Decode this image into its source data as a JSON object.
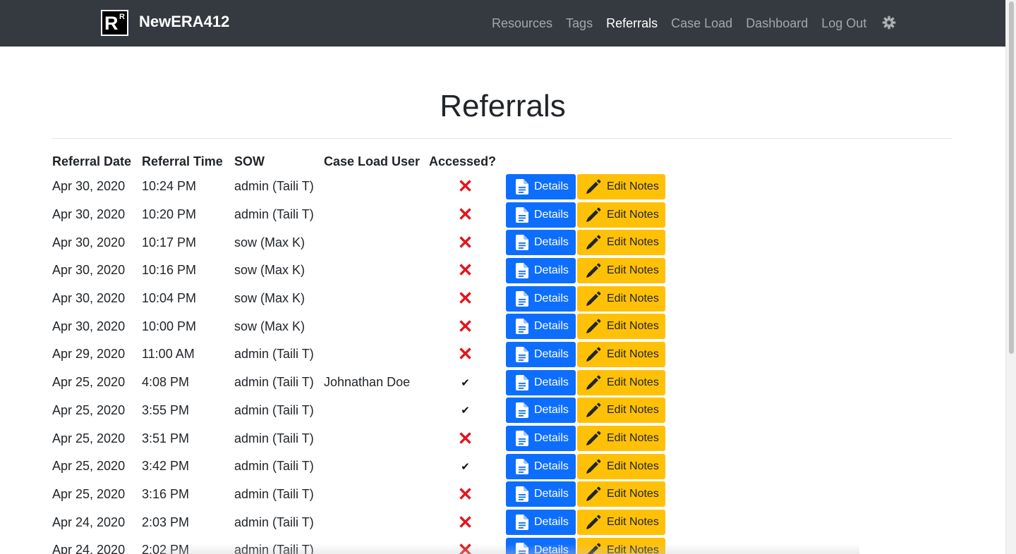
{
  "app": {
    "logo_big": "R",
    "logo_small": "R",
    "brand": "NewERA412"
  },
  "nav": {
    "items": [
      {
        "label": "Resources",
        "active": false
      },
      {
        "label": "Tags",
        "active": false
      },
      {
        "label": "Referrals",
        "active": true
      },
      {
        "label": "Case Load",
        "active": false
      },
      {
        "label": "Dashboard",
        "active": false
      },
      {
        "label": "Log Out",
        "active": false
      }
    ],
    "settings_icon": "gear-icon"
  },
  "page": {
    "title": "Referrals"
  },
  "table": {
    "headers": [
      "Referral Date",
      "Referral Time",
      "SOW",
      "Case Load User",
      "Accessed?"
    ],
    "details_label": "Details",
    "notes_label": "Edit Notes",
    "rows": [
      {
        "date": "Apr 30, 2020",
        "time": "10:24 PM",
        "sow": "admin (Taili T)",
        "user": "",
        "accessed": false
      },
      {
        "date": "Apr 30, 2020",
        "time": "10:20 PM",
        "sow": "admin (Taili T)",
        "user": "",
        "accessed": false
      },
      {
        "date": "Apr 30, 2020",
        "time": "10:17 PM",
        "sow": "sow (Max K)",
        "user": "",
        "accessed": false
      },
      {
        "date": "Apr 30, 2020",
        "time": "10:16 PM",
        "sow": "sow (Max K)",
        "user": "",
        "accessed": false
      },
      {
        "date": "Apr 30, 2020",
        "time": "10:04 PM",
        "sow": "sow (Max K)",
        "user": "",
        "accessed": false
      },
      {
        "date": "Apr 30, 2020",
        "time": "10:00 PM",
        "sow": "sow (Max K)",
        "user": "",
        "accessed": false
      },
      {
        "date": "Apr 29, 2020",
        "time": "11:00 AM",
        "sow": "admin (Taili T)",
        "user": "",
        "accessed": false
      },
      {
        "date": "Apr 25, 2020",
        "time": "4:08 PM",
        "sow": "admin (Taili T)",
        "user": "Johnathan Doe",
        "accessed": true
      },
      {
        "date": "Apr 25, 2020",
        "time": "3:55 PM",
        "sow": "admin (Taili T)",
        "user": "",
        "accessed": true
      },
      {
        "date": "Apr 25, 2020",
        "time": "3:51 PM",
        "sow": "admin (Taili T)",
        "user": "",
        "accessed": false
      },
      {
        "date": "Apr 25, 2020",
        "time": "3:42 PM",
        "sow": "admin (Taili T)",
        "user": "",
        "accessed": true
      },
      {
        "date": "Apr 25, 2020",
        "time": "3:16 PM",
        "sow": "admin (Taili T)",
        "user": "",
        "accessed": false
      },
      {
        "date": "Apr 24, 2020",
        "time": "2:03 PM",
        "sow": "admin (Taili T)",
        "user": "",
        "accessed": false
      },
      {
        "date": "Apr 24, 2020",
        "time": "2:02 PM",
        "sow": "admin (Taili T)",
        "user": "",
        "accessed": false
      }
    ]
  },
  "icons": {
    "accessed_yes": "✔",
    "accessed_no": "✕",
    "details": "file-text-icon",
    "notes": "pencil-icon"
  },
  "colors": {
    "navbar": "#343a40",
    "details_button": "#0d6efd",
    "notes_button": "#ffc107",
    "not_accessed": "#e3151c"
  }
}
